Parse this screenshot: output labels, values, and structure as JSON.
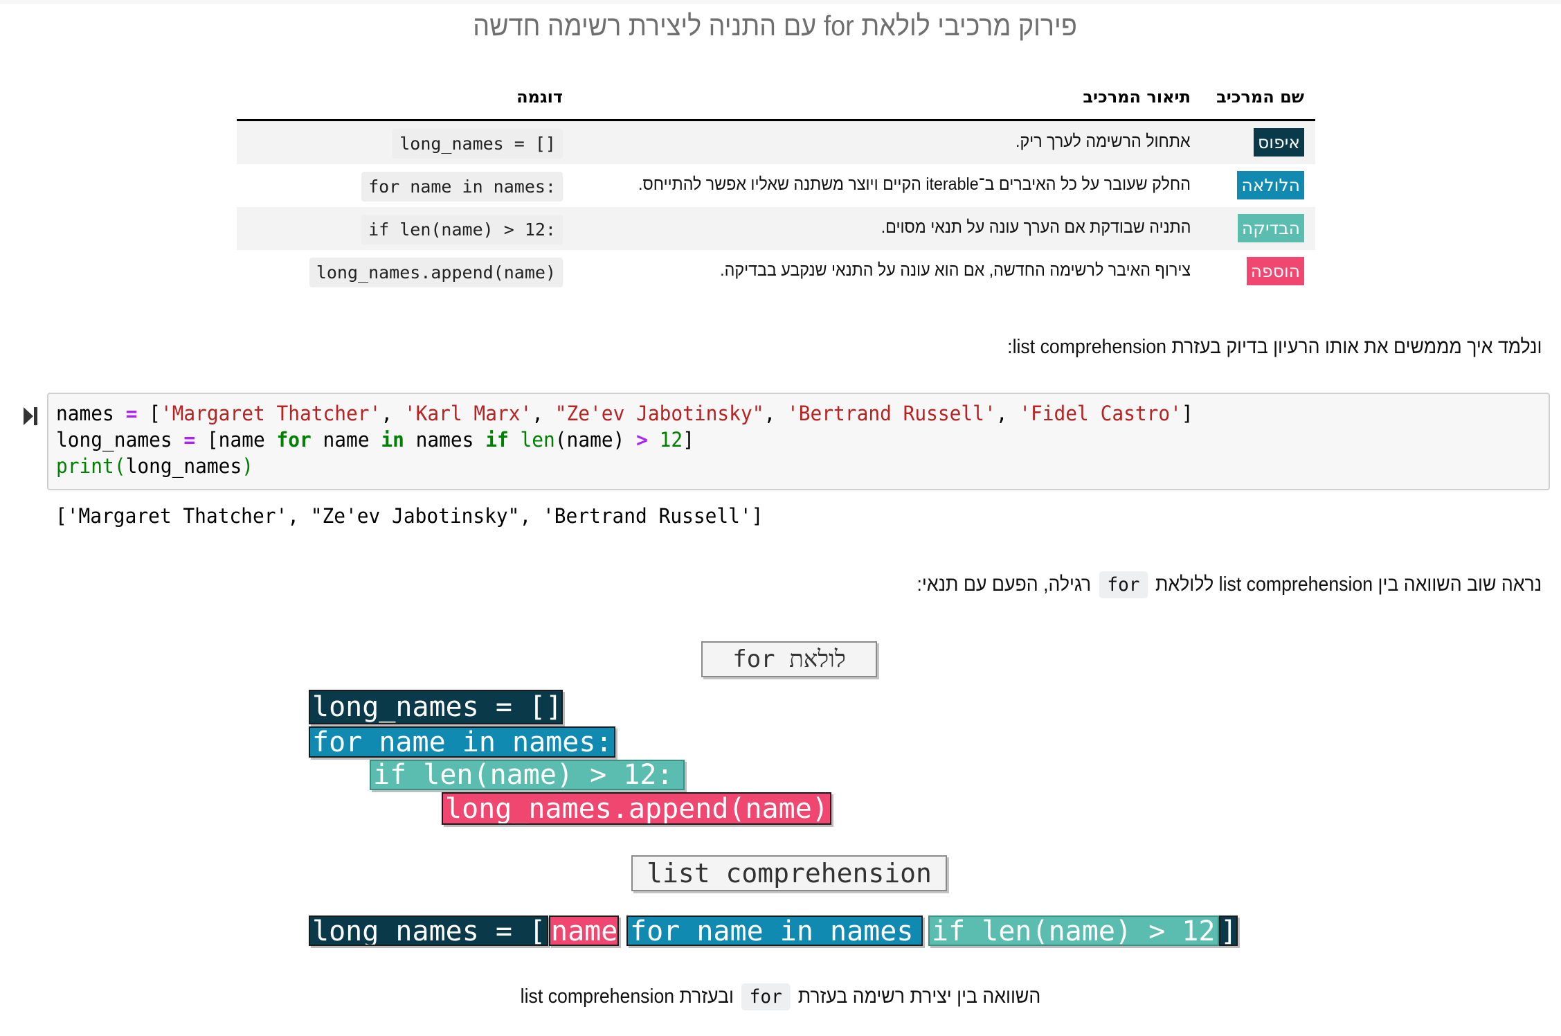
{
  "title": "פירוק מרכיבי לולאת for עם התניה ליצירת רשימה חדשה",
  "table": {
    "headers": {
      "name": "שם המרכיב",
      "description": "תיאור המרכיב",
      "example": "דוגמה"
    },
    "rows": [
      {
        "badge": "איפוס",
        "color": "#0a3a4a",
        "description": "אתחול הרשימה לערך ריק.",
        "example": "long_names = []"
      },
      {
        "badge": "הלולאה",
        "color": "#118ab2",
        "description": "החלק שעובר על כל האיברים ב־iterable הקיים ויוצר משתנה שאליו אפשר להתייחס.",
        "example": "for name in names:"
      },
      {
        "badge": "הבדיקה",
        "color": "#5bbdaf",
        "description": "התניה שבודקת אם הערך עונה על תנאי מסוים.",
        "example": "if len(name) > 12:"
      },
      {
        "badge": "הוספה",
        "color": "#ef476f",
        "description": "צירוף האיבר לרשימה החדשה, אם הוא עונה על התנאי שנקבע בבדיקה.",
        "example": "long_names.append(name)"
      }
    ]
  },
  "intro_paragraph": "ונלמד איך מממשים את אותו הרעיון בדיוק בעזרת list comprehension:",
  "code_cell": {
    "run_icon": "run-cell-icon",
    "lines": [
      [
        {
          "t": "names ",
          "c": ""
        },
        {
          "t": "=",
          "c": "o"
        },
        {
          "t": " [",
          "c": ""
        },
        {
          "t": "'Margaret Thatcher'",
          "c": "s"
        },
        {
          "t": ", ",
          "c": ""
        },
        {
          "t": "'Karl Marx'",
          "c": "s"
        },
        {
          "t": ", ",
          "c": ""
        },
        {
          "t": "\"Ze'ev Jabotinsky\"",
          "c": "s"
        },
        {
          "t": ", ",
          "c": ""
        },
        {
          "t": "'Bertrand Russell'",
          "c": "s"
        },
        {
          "t": ", ",
          "c": ""
        },
        {
          "t": "'Fidel Castro'",
          "c": "s"
        },
        {
          "t": "]",
          "c": ""
        }
      ],
      [
        {
          "t": "long_names ",
          "c": ""
        },
        {
          "t": "=",
          "c": "o"
        },
        {
          "t": " [name ",
          "c": ""
        },
        {
          "t": "for",
          "c": "k"
        },
        {
          "t": " name ",
          "c": ""
        },
        {
          "t": "in",
          "c": "k"
        },
        {
          "t": " names ",
          "c": ""
        },
        {
          "t": "if",
          "c": "k"
        },
        {
          "t": " ",
          "c": ""
        },
        {
          "t": "len",
          "c": "b"
        },
        {
          "t": "(name) ",
          "c": ""
        },
        {
          "t": ">",
          "c": "o"
        },
        {
          "t": " ",
          "c": ""
        },
        {
          "t": "12",
          "c": "n"
        },
        {
          "t": "]",
          "c": ""
        }
      ],
      [
        {
          "t": "print",
          "c": "b"
        },
        {
          "t": "(",
          "c": "b"
        },
        {
          "t": "long_names",
          "c": ""
        },
        {
          "t": ")",
          "c": "b"
        }
      ]
    ],
    "output": "['Margaret Thatcher', \"Ze'ev Jabotinsky\", 'Bertrand Russell']"
  },
  "compare_paragraph": {
    "before": "נראה שוב השוואה בין list comprehension ללולאת",
    "code": "for",
    "after": "רגילה, הפעם עם תנאי:"
  },
  "diagram": {
    "for_label": "for לולאת",
    "for_lines": [
      "long_names = []",
      "for name in names:",
      "if len(name) > 12:",
      "long_names.append(name)"
    ],
    "lc_label": "list comprehension",
    "lc_parts": [
      "long_names = [",
      "name",
      "for name in names",
      "if len(name) > 12",
      "]"
    ],
    "colors": {
      "init": "#0a3a4a",
      "loop": "#118ab2",
      "cond": "#5bbdaf",
      "add": "#ef476f"
    }
  },
  "caption": {
    "before": "השוואה בין יצירת רשימה בעזרת",
    "code": "for",
    "after": "ובעזרת list comprehension"
  }
}
